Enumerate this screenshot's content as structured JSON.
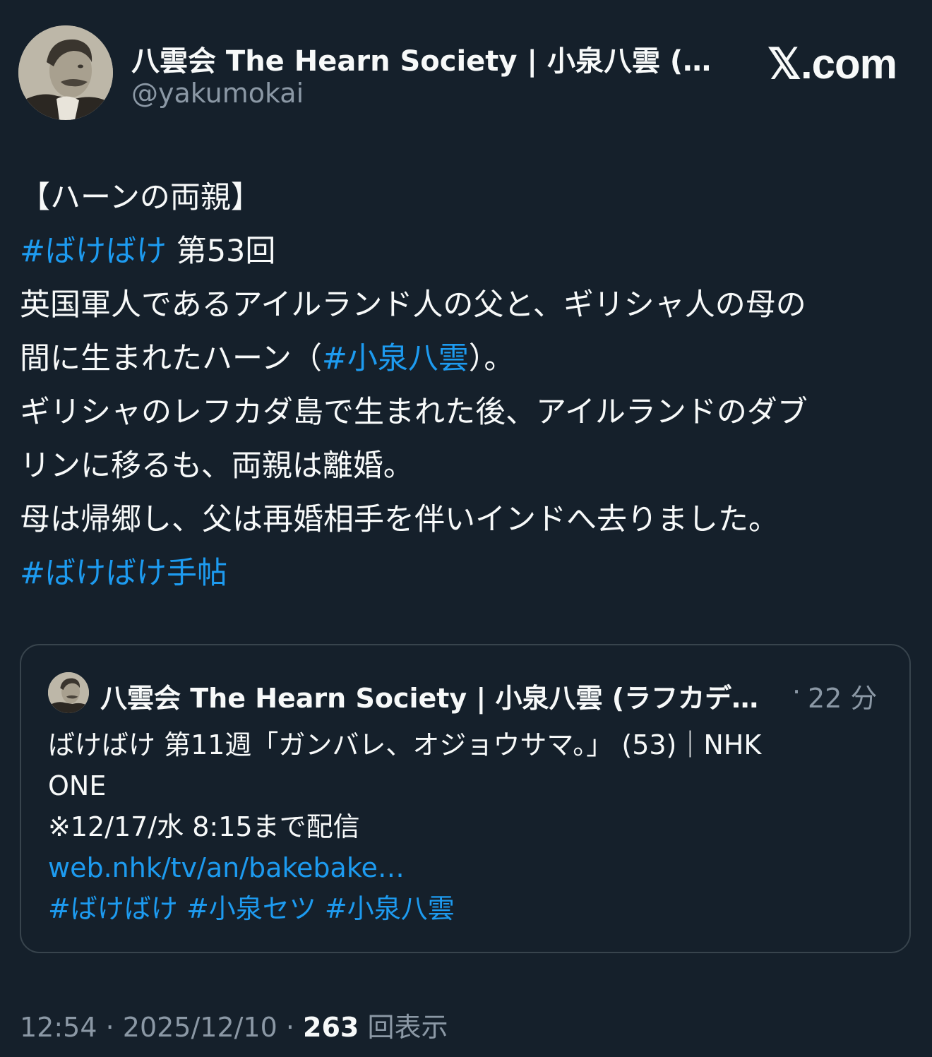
{
  "author": {
    "display_name": "八雲会 The Hearn Society | 小泉八雲 (ラ…",
    "handle": "@yakumokai"
  },
  "brand": {
    "logo_text": "𝕏.com"
  },
  "post": {
    "lines": [
      {
        "segments": [
          {
            "text": "【ハーンの両親】",
            "type": "text"
          }
        ]
      },
      {
        "segments": [
          {
            "text": "#ばけばけ",
            "type": "hashtag"
          },
          {
            "text": " 第53回",
            "type": "text"
          }
        ]
      },
      {
        "segments": [
          {
            "text": "英国軍人であるアイルランド人の父と、ギリシャ人の母の",
            "type": "text"
          }
        ]
      },
      {
        "segments": [
          {
            "text": "間に生まれたハーン（",
            "type": "text"
          },
          {
            "text": "#小泉八雲",
            "type": "hashtag"
          },
          {
            "text": "）。",
            "type": "text"
          }
        ]
      },
      {
        "segments": [
          {
            "text": "ギリシャのレフカダ島で生まれた後、アイルランドのダブ",
            "type": "text"
          }
        ]
      },
      {
        "segments": [
          {
            "text": "リンに移るも、両親は離婚。",
            "type": "text"
          }
        ]
      },
      {
        "segments": [
          {
            "text": "母は帰郷し、父は再婚相手を伴いインドへ去りました。",
            "type": "text"
          }
        ]
      },
      {
        "segments": [
          {
            "text": "#ばけばけ手帖",
            "type": "hashtag"
          }
        ]
      }
    ]
  },
  "quoted": {
    "display_name": "八雲会 The Hearn Society | 小泉八雲 (ラフカデ…",
    "separator": "·",
    "time": "22 分",
    "lines": [
      {
        "segments": [
          {
            "text": "ばけばけ 第11週「ガンバレ、オジョウサマ。」 (53)｜NHK",
            "type": "text"
          }
        ]
      },
      {
        "segments": [
          {
            "text": "ONE",
            "type": "text"
          }
        ]
      },
      {
        "segments": [
          {
            "text": "※12/17/水 8:15まで配信",
            "type": "text"
          }
        ]
      },
      {
        "segments": [
          {
            "text": "web.nhk/tv/an/bakebake…",
            "type": "link"
          }
        ]
      },
      {
        "segments": [
          {
            "text": "#ばけばけ",
            "type": "hashtag"
          },
          {
            "text": " ",
            "type": "text"
          },
          {
            "text": "#小泉セツ",
            "type": "hashtag"
          },
          {
            "text": " ",
            "type": "text"
          },
          {
            "text": "#小泉八雲",
            "type": "hashtag"
          }
        ]
      }
    ]
  },
  "meta": {
    "time": "12:54",
    "sep1": " · ",
    "date": "2025/12/10",
    "sep2": " · ",
    "views_count": "263",
    "views_label": " 回表示"
  },
  "colors": {
    "background": "#15202b",
    "text": "#f7f9f9",
    "muted": "#8b98a5",
    "accent": "#1d9bf0",
    "border": "#38444d"
  }
}
